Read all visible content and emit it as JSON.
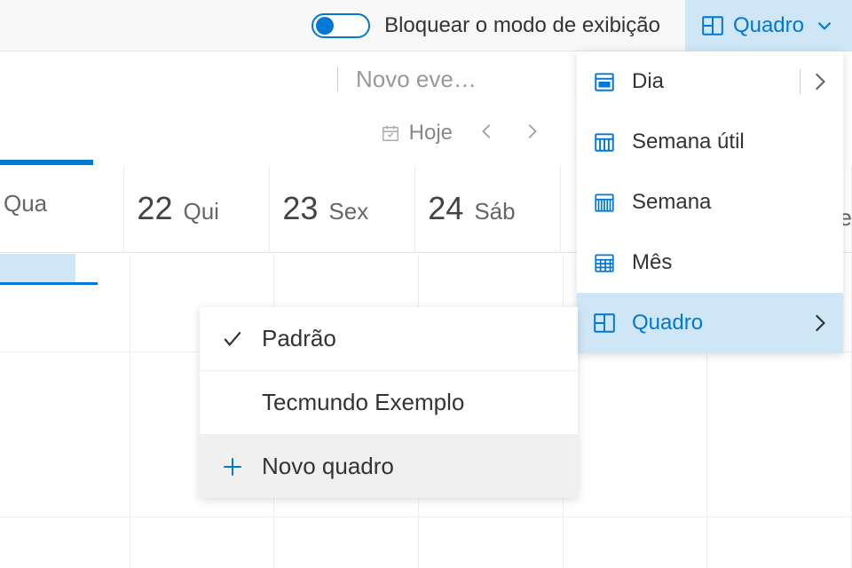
{
  "topbar": {
    "toggle_label": "Bloquear o modo de exibição",
    "view_label": "Quadro"
  },
  "subbar": {
    "new_event": "Novo eve…",
    "today": "Hoje"
  },
  "days": [
    {
      "num": "",
      "name": "Qua"
    },
    {
      "num": "22",
      "name": "Qui"
    },
    {
      "num": "23",
      "name": "Sex"
    },
    {
      "num": "24",
      "name": "Sáb"
    }
  ],
  "view_menu": [
    {
      "label": "Dia",
      "icon": "day",
      "chevron": true,
      "vline": true
    },
    {
      "label": "Semana útil",
      "icon": "workweek"
    },
    {
      "label": "Semana",
      "icon": "week"
    },
    {
      "label": "Mês",
      "icon": "month"
    },
    {
      "label": "Quadro",
      "icon": "board",
      "chevron": true,
      "active": true
    }
  ],
  "sub_menu": {
    "default": "Padrão",
    "example": "Tecmundo Exemplo",
    "new": "Novo quadro"
  },
  "edge_letter": "e",
  "colors": {
    "accent": "#0078d4",
    "highlight": "#cfe6f7"
  }
}
